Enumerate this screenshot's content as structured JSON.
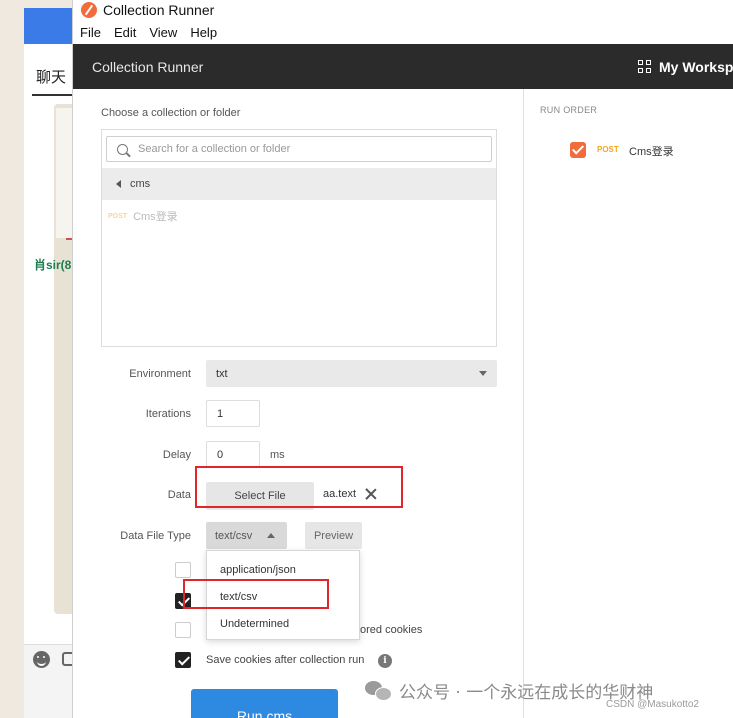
{
  "background_app": {
    "tab_label": "聊天",
    "contact_name": "肖sir(8"
  },
  "window": {
    "title": "Collection Runner",
    "menu": [
      "File",
      "Edit",
      "View",
      "Help"
    ],
    "header_title": "Collection Runner",
    "workspace_label": "My Workspa"
  },
  "collection_picker": {
    "label": "Choose a collection or folder",
    "search_placeholder": "Search for a collection or folder",
    "folder_name": "cms",
    "request_method": "POST",
    "request_name": "Cms登录"
  },
  "form": {
    "environment_label": "Environment",
    "environment_value": "txt",
    "iterations_label": "Iterations",
    "iterations_value": "1",
    "delay_label": "Delay",
    "delay_value": "0",
    "delay_unit": "ms",
    "data_label": "Data",
    "select_file_label": "Select File",
    "file_name": "aa.text",
    "data_file_type_label": "Data File Type",
    "data_file_type_value": "text/csv",
    "preview_label": "Preview",
    "data_file_type_options": [
      "application/json",
      "text/csv",
      "Undetermined"
    ],
    "option_partial_label": "ored cookies",
    "save_cookies_label": "Save cookies after collection run",
    "save_cookies_checked": true,
    "run_button_label": "Run cms"
  },
  "run_order": {
    "label": "RUN ORDER",
    "items": [
      {
        "method": "POST",
        "name": "Cms登录",
        "checked": true
      }
    ]
  },
  "watermark": {
    "text": "公众号 · 一个永远在成长的华财神",
    "credit": "CSDN @Masukotto2"
  },
  "colors": {
    "header_bg": "#2b2b2b",
    "accent_orange": "#f26b3a",
    "post_color": "#f5a623",
    "run_button": "#2d8ae0",
    "highlight_red": "#e0262c"
  }
}
